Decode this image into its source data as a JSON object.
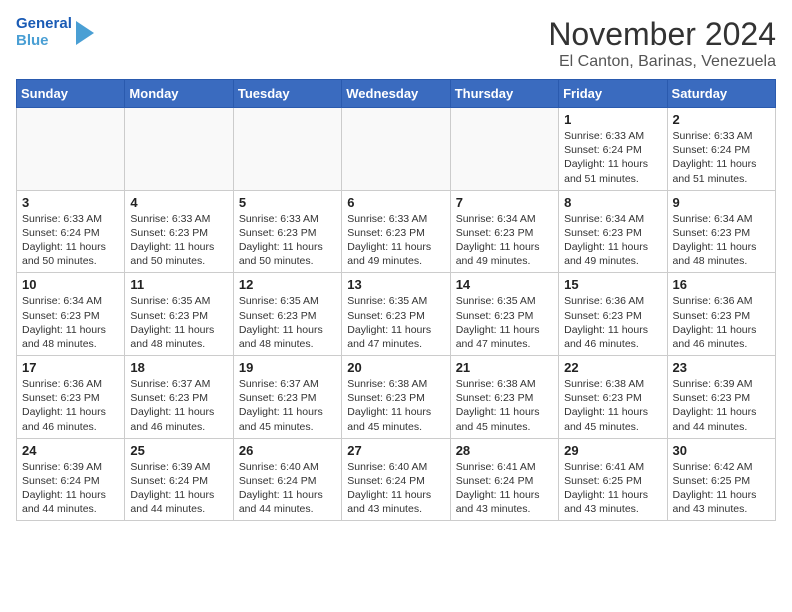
{
  "header": {
    "logo_line1": "General",
    "logo_line2": "Blue",
    "title": "November 2024",
    "subtitle": "El Canton, Barinas, Venezuela"
  },
  "weekdays": [
    "Sunday",
    "Monday",
    "Tuesday",
    "Wednesday",
    "Thursday",
    "Friday",
    "Saturday"
  ],
  "weeks": [
    [
      {
        "day": "",
        "info": ""
      },
      {
        "day": "",
        "info": ""
      },
      {
        "day": "",
        "info": ""
      },
      {
        "day": "",
        "info": ""
      },
      {
        "day": "",
        "info": ""
      },
      {
        "day": "1",
        "info": "Sunrise: 6:33 AM\nSunset: 6:24 PM\nDaylight: 11 hours and 51 minutes."
      },
      {
        "day": "2",
        "info": "Sunrise: 6:33 AM\nSunset: 6:24 PM\nDaylight: 11 hours and 51 minutes."
      }
    ],
    [
      {
        "day": "3",
        "info": "Sunrise: 6:33 AM\nSunset: 6:24 PM\nDaylight: 11 hours and 50 minutes."
      },
      {
        "day": "4",
        "info": "Sunrise: 6:33 AM\nSunset: 6:23 PM\nDaylight: 11 hours and 50 minutes."
      },
      {
        "day": "5",
        "info": "Sunrise: 6:33 AM\nSunset: 6:23 PM\nDaylight: 11 hours and 50 minutes."
      },
      {
        "day": "6",
        "info": "Sunrise: 6:33 AM\nSunset: 6:23 PM\nDaylight: 11 hours and 49 minutes."
      },
      {
        "day": "7",
        "info": "Sunrise: 6:34 AM\nSunset: 6:23 PM\nDaylight: 11 hours and 49 minutes."
      },
      {
        "day": "8",
        "info": "Sunrise: 6:34 AM\nSunset: 6:23 PM\nDaylight: 11 hours and 49 minutes."
      },
      {
        "day": "9",
        "info": "Sunrise: 6:34 AM\nSunset: 6:23 PM\nDaylight: 11 hours and 48 minutes."
      }
    ],
    [
      {
        "day": "10",
        "info": "Sunrise: 6:34 AM\nSunset: 6:23 PM\nDaylight: 11 hours and 48 minutes."
      },
      {
        "day": "11",
        "info": "Sunrise: 6:35 AM\nSunset: 6:23 PM\nDaylight: 11 hours and 48 minutes."
      },
      {
        "day": "12",
        "info": "Sunrise: 6:35 AM\nSunset: 6:23 PM\nDaylight: 11 hours and 48 minutes."
      },
      {
        "day": "13",
        "info": "Sunrise: 6:35 AM\nSunset: 6:23 PM\nDaylight: 11 hours and 47 minutes."
      },
      {
        "day": "14",
        "info": "Sunrise: 6:35 AM\nSunset: 6:23 PM\nDaylight: 11 hours and 47 minutes."
      },
      {
        "day": "15",
        "info": "Sunrise: 6:36 AM\nSunset: 6:23 PM\nDaylight: 11 hours and 46 minutes."
      },
      {
        "day": "16",
        "info": "Sunrise: 6:36 AM\nSunset: 6:23 PM\nDaylight: 11 hours and 46 minutes."
      }
    ],
    [
      {
        "day": "17",
        "info": "Sunrise: 6:36 AM\nSunset: 6:23 PM\nDaylight: 11 hours and 46 minutes."
      },
      {
        "day": "18",
        "info": "Sunrise: 6:37 AM\nSunset: 6:23 PM\nDaylight: 11 hours and 46 minutes."
      },
      {
        "day": "19",
        "info": "Sunrise: 6:37 AM\nSunset: 6:23 PM\nDaylight: 11 hours and 45 minutes."
      },
      {
        "day": "20",
        "info": "Sunrise: 6:38 AM\nSunset: 6:23 PM\nDaylight: 11 hours and 45 minutes."
      },
      {
        "day": "21",
        "info": "Sunrise: 6:38 AM\nSunset: 6:23 PM\nDaylight: 11 hours and 45 minutes."
      },
      {
        "day": "22",
        "info": "Sunrise: 6:38 AM\nSunset: 6:23 PM\nDaylight: 11 hours and 45 minutes."
      },
      {
        "day": "23",
        "info": "Sunrise: 6:39 AM\nSunset: 6:23 PM\nDaylight: 11 hours and 44 minutes."
      }
    ],
    [
      {
        "day": "24",
        "info": "Sunrise: 6:39 AM\nSunset: 6:24 PM\nDaylight: 11 hours and 44 minutes."
      },
      {
        "day": "25",
        "info": "Sunrise: 6:39 AM\nSunset: 6:24 PM\nDaylight: 11 hours and 44 minutes."
      },
      {
        "day": "26",
        "info": "Sunrise: 6:40 AM\nSunset: 6:24 PM\nDaylight: 11 hours and 44 minutes."
      },
      {
        "day": "27",
        "info": "Sunrise: 6:40 AM\nSunset: 6:24 PM\nDaylight: 11 hours and 43 minutes."
      },
      {
        "day": "28",
        "info": "Sunrise: 6:41 AM\nSunset: 6:24 PM\nDaylight: 11 hours and 43 minutes."
      },
      {
        "day": "29",
        "info": "Sunrise: 6:41 AM\nSunset: 6:25 PM\nDaylight: 11 hours and 43 minutes."
      },
      {
        "day": "30",
        "info": "Sunrise: 6:42 AM\nSunset: 6:25 PM\nDaylight: 11 hours and 43 minutes."
      }
    ]
  ]
}
